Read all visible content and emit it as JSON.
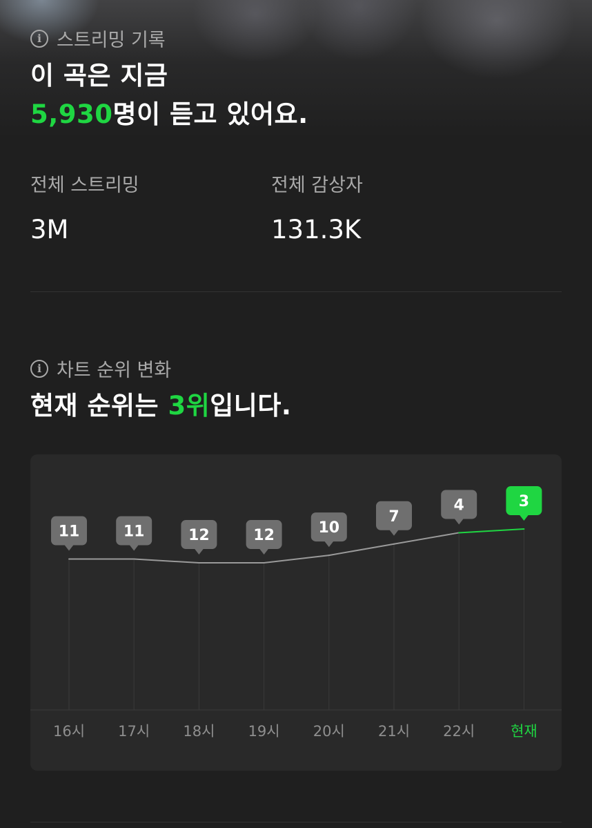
{
  "streaming": {
    "section_title": "스트리밍 기록",
    "headline_line1": "이 곡은 지금",
    "listener_count": "5,930",
    "headline_line2_suffix": "명이 듣고 있어요.",
    "total_streaming_label": "전체 스트리밍",
    "total_streaming_value": "3M",
    "total_listeners_label": "전체 감상자",
    "total_listeners_value": "131.3K"
  },
  "rank_section": {
    "section_title": "차트 순위 변화",
    "headline_prefix": "현재 순위는 ",
    "current_rank": "3위",
    "headline_suffix": "입니다."
  },
  "colors": {
    "accent": "#1fd642",
    "badge_gray": "#6f6f6f",
    "line_gray": "#9a9a9a",
    "background": "#1f1f1f",
    "card": "#292929"
  },
  "icons": [
    "info-icon"
  ],
  "chart_data": {
    "type": "line",
    "title": "",
    "xlabel": "",
    "ylabel": "",
    "y_inverted": true,
    "categories": [
      "16시",
      "17시",
      "18시",
      "19시",
      "20시",
      "21시",
      "22시",
      "현재"
    ],
    "series": [
      {
        "values": [
          11,
          11,
          12,
          12,
          10,
          7,
          4,
          3
        ]
      }
    ],
    "highlight_index": 7
  }
}
